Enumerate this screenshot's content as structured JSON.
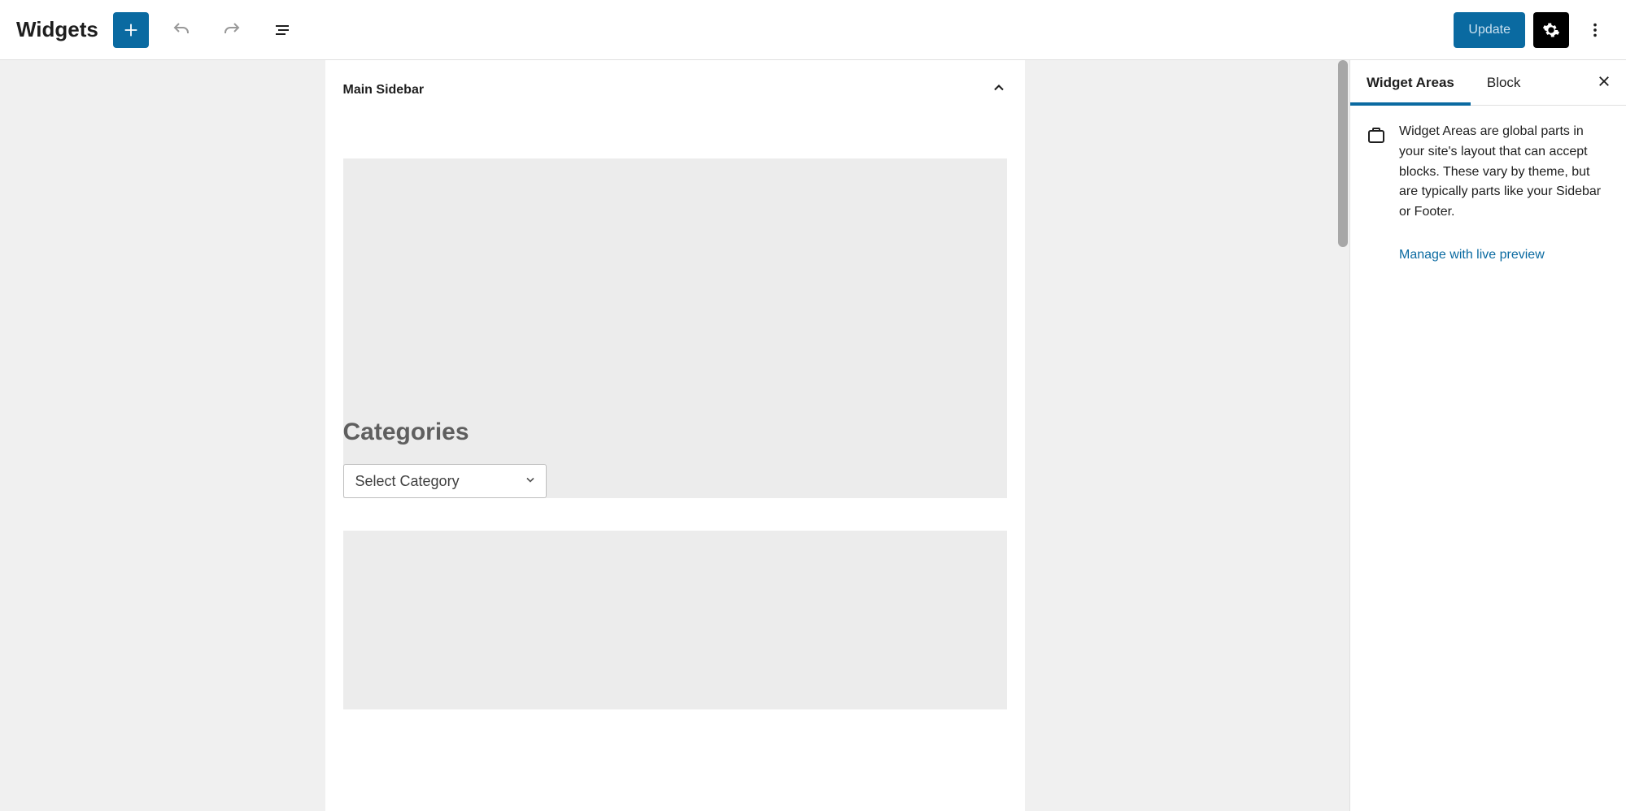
{
  "header": {
    "title": "Widgets",
    "update_label": "Update"
  },
  "main": {
    "area_title": "Main Sidebar",
    "categories": {
      "heading": "Categories",
      "select_placeholder": "Select Category"
    }
  },
  "settings": {
    "tabs": {
      "widget_areas": "Widget Areas",
      "block": "Block"
    },
    "description": "Widget Areas are global parts in your site's layout that can accept blocks. These vary by theme, but are typically parts like your Sidebar or Footer.",
    "manage_link": "Manage with live preview"
  }
}
